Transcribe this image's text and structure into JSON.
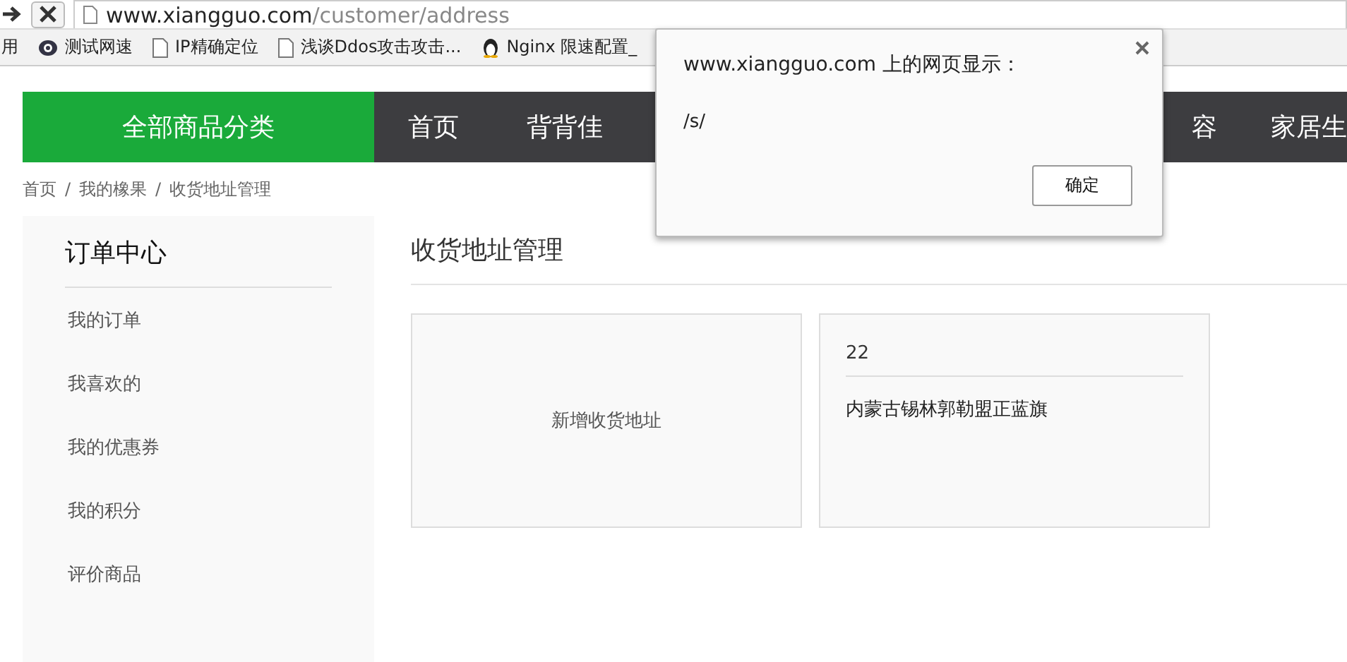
{
  "browser": {
    "url_host": "www.xiangguo.com",
    "url_path": "/customer/address"
  },
  "bookmarks": [
    {
      "kind": "text",
      "label": "用"
    },
    {
      "kind": "eye",
      "label": "测试网速"
    },
    {
      "kind": "page",
      "label": "IP精确定位"
    },
    {
      "kind": "page",
      "label": "浅谈Ddos攻击攻击..."
    },
    {
      "kind": "penguin",
      "label": "Nginx 限速配置_"
    }
  ],
  "nav": {
    "category_button": "全部商品分类",
    "items": [
      "首页",
      "背背佳"
    ],
    "right_items": [
      "容",
      "家居生"
    ]
  },
  "breadcrumb": [
    "首页",
    "我的橡果",
    "收货地址管理"
  ],
  "breadcrumb_separator": "/",
  "sidebar": {
    "heading": "订单中心",
    "items": [
      "我的订单",
      "我喜欢的",
      "我的优惠券",
      "我的积分",
      "评价商品"
    ]
  },
  "main": {
    "title": "收货地址管理",
    "add_card": "新增收货地址",
    "addresses": [
      {
        "name": "22",
        "address": "内蒙古锡林郭勒盟正蓝旗"
      }
    ]
  },
  "dialog": {
    "title": "www.xiangguo.com 上的网页显示：",
    "message": "/s/",
    "ok_button": "确定"
  }
}
